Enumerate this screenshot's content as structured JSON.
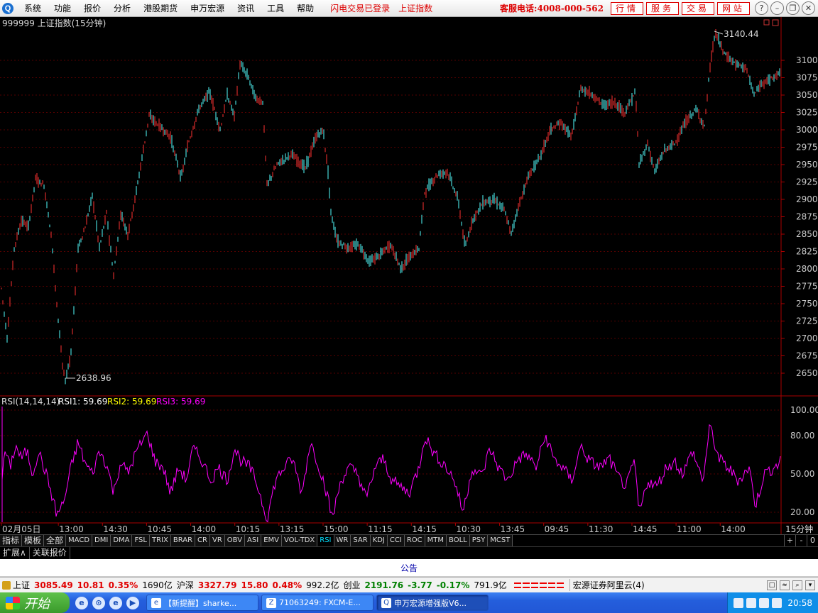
{
  "menubar": {
    "logo": "Q",
    "items": [
      "系统",
      "功能",
      "报价",
      "分析",
      "港股期货",
      "申万宏源",
      "资讯",
      "工具",
      "帮助"
    ],
    "notice_login": "闪电交易已登录",
    "notice_index": "上证指数",
    "hotline": "客服电话:4008-000-562",
    "buttons": [
      "行情",
      "服务",
      "交易",
      "网站"
    ]
  },
  "chart": {
    "title": "999999 上证指数(15分钟)",
    "y_ticks": [
      "3100",
      "3075",
      "3050",
      "3025",
      "3000",
      "2975",
      "2950",
      "2925",
      "2900",
      "2875",
      "2850",
      "2825",
      "2800",
      "2775",
      "2750",
      "2725",
      "2700",
      "2675",
      "2650"
    ],
    "high_label": "3140.44",
    "low_label": "2638.96",
    "rsi_legend": {
      "name": "RSI(14,14,14)",
      "rsi1": "RSI1: 59.69",
      "rsi2": "RSI2: 59.69",
      "rsi3": "RSI3: 59.69"
    },
    "rsi_ticks": [
      "100.00",
      "80.00",
      "50.00",
      "20.00"
    ],
    "x_labels": [
      "02月05日",
      "13:00",
      "14:30",
      "10:45",
      "14:00",
      "10:15",
      "13:15",
      "15:00",
      "11:15",
      "14:15",
      "10:30",
      "13:45",
      "09:45",
      "11:30",
      "14:45",
      "11:00",
      "14:00"
    ],
    "period": "15分钟"
  },
  "chart_data": {
    "type": "candlestick",
    "title": "999999 上证指数(15分钟)",
    "ylim": [
      2620,
      3150
    ],
    "high": 3140.44,
    "low": 2638.96,
    "last_close": 3085.49,
    "price_path": [
      {
        "x": 0,
        "y": 2790
      },
      {
        "x": 10,
        "y": 2700
      },
      {
        "x": 20,
        "y": 2830
      },
      {
        "x": 30,
        "y": 2870
      },
      {
        "x": 40,
        "y": 2860
      },
      {
        "x": 50,
        "y": 2930
      },
      {
        "x": 62,
        "y": 2920
      },
      {
        "x": 72,
        "y": 2850
      },
      {
        "x": 80,
        "y": 2750
      },
      {
        "x": 88,
        "y": 2660
      },
      {
        "x": 92,
        "y": 2639
      },
      {
        "x": 100,
        "y": 2680
      },
      {
        "x": 110,
        "y": 2830
      },
      {
        "x": 120,
        "y": 2860
      },
      {
        "x": 130,
        "y": 2905
      },
      {
        "x": 140,
        "y": 2830
      },
      {
        "x": 150,
        "y": 2880
      },
      {
        "x": 160,
        "y": 2790
      },
      {
        "x": 170,
        "y": 2880
      },
      {
        "x": 180,
        "y": 2850
      },
      {
        "x": 190,
        "y": 2900
      },
      {
        "x": 200,
        "y": 2960
      },
      {
        "x": 210,
        "y": 3020
      },
      {
        "x": 225,
        "y": 3005
      },
      {
        "x": 240,
        "y": 2990
      },
      {
        "x": 255,
        "y": 2930
      },
      {
        "x": 265,
        "y": 2980
      },
      {
        "x": 280,
        "y": 3030
      },
      {
        "x": 295,
        "y": 3055
      },
      {
        "x": 310,
        "y": 3000
      },
      {
        "x": 320,
        "y": 3050
      },
      {
        "x": 330,
        "y": 3020
      },
      {
        "x": 338,
        "y": 3095
      },
      {
        "x": 350,
        "y": 3075
      },
      {
        "x": 360,
        "y": 3045
      },
      {
        "x": 370,
        "y": 3040
      },
      {
        "x": 376,
        "y": 2920
      },
      {
        "x": 390,
        "y": 2950
      },
      {
        "x": 410,
        "y": 2965
      },
      {
        "x": 430,
        "y": 2945
      },
      {
        "x": 445,
        "y": 2990
      },
      {
        "x": 455,
        "y": 3000
      },
      {
        "x": 462,
        "y": 2940
      },
      {
        "x": 466,
        "y": 2880
      },
      {
        "x": 475,
        "y": 2840
      },
      {
        "x": 490,
        "y": 2830
      },
      {
        "x": 505,
        "y": 2835
      },
      {
        "x": 520,
        "y": 2810
      },
      {
        "x": 535,
        "y": 2820
      },
      {
        "x": 550,
        "y": 2835
      },
      {
        "x": 565,
        "y": 2800
      },
      {
        "x": 575,
        "y": 2815
      },
      {
        "x": 590,
        "y": 2830
      },
      {
        "x": 598,
        "y": 2910
      },
      {
        "x": 615,
        "y": 2935
      },
      {
        "x": 630,
        "y": 2940
      },
      {
        "x": 645,
        "y": 2900
      },
      {
        "x": 655,
        "y": 2830
      },
      {
        "x": 665,
        "y": 2870
      },
      {
        "x": 680,
        "y": 2895
      },
      {
        "x": 695,
        "y": 2900
      },
      {
        "x": 710,
        "y": 2885
      },
      {
        "x": 720,
        "y": 2850
      },
      {
        "x": 730,
        "y": 2890
      },
      {
        "x": 745,
        "y": 2935
      },
      {
        "x": 760,
        "y": 2960
      },
      {
        "x": 775,
        "y": 3000
      },
      {
        "x": 790,
        "y": 3010
      },
      {
        "x": 805,
        "y": 2990
      },
      {
        "x": 818,
        "y": 3060
      },
      {
        "x": 835,
        "y": 3050
      },
      {
        "x": 850,
        "y": 3035
      },
      {
        "x": 865,
        "y": 3040
      },
      {
        "x": 880,
        "y": 3025
      },
      {
        "x": 895,
        "y": 3055
      },
      {
        "x": 900,
        "y": 2950
      },
      {
        "x": 912,
        "y": 2980
      },
      {
        "x": 922,
        "y": 2940
      },
      {
        "x": 935,
        "y": 2970
      },
      {
        "x": 950,
        "y": 2980
      },
      {
        "x": 965,
        "y": 3010
      },
      {
        "x": 980,
        "y": 3030
      },
      {
        "x": 992,
        "y": 3005
      },
      {
        "x": 1000,
        "y": 3090
      },
      {
        "x": 1007,
        "y": 3140
      },
      {
        "x": 1020,
        "y": 3110
      },
      {
        "x": 1035,
        "y": 3095
      },
      {
        "x": 1050,
        "y": 3090
      },
      {
        "x": 1062,
        "y": 3050
      },
      {
        "x": 1075,
        "y": 3070
      },
      {
        "x": 1090,
        "y": 3075
      },
      {
        "x": 1100,
        "y": 3085
      }
    ],
    "rsi_path": [
      {
        "x": 0,
        "y": 12
      },
      {
        "x": 6,
        "y": 70
      },
      {
        "x": 14,
        "y": 55
      },
      {
        "x": 22,
        "y": 72
      },
      {
        "x": 30,
        "y": 62
      },
      {
        "x": 38,
        "y": 68
      },
      {
        "x": 46,
        "y": 50
      },
      {
        "x": 54,
        "y": 68
      },
      {
        "x": 62,
        "y": 55
      },
      {
        "x": 70,
        "y": 40
      },
      {
        "x": 80,
        "y": 18
      },
      {
        "x": 90,
        "y": 28
      },
      {
        "x": 100,
        "y": 55
      },
      {
        "x": 110,
        "y": 75
      },
      {
        "x": 120,
        "y": 58
      },
      {
        "x": 130,
        "y": 50
      },
      {
        "x": 140,
        "y": 68
      },
      {
        "x": 150,
        "y": 58
      },
      {
        "x": 160,
        "y": 35
      },
      {
        "x": 170,
        "y": 60
      },
      {
        "x": 180,
        "y": 50
      },
      {
        "x": 190,
        "y": 65
      },
      {
        "x": 200,
        "y": 75
      },
      {
        "x": 208,
        "y": 82
      },
      {
        "x": 218,
        "y": 60
      },
      {
        "x": 230,
        "y": 55
      },
      {
        "x": 240,
        "y": 35
      },
      {
        "x": 252,
        "y": 55
      },
      {
        "x": 262,
        "y": 45
      },
      {
        "x": 272,
        "y": 70
      },
      {
        "x": 285,
        "y": 60
      },
      {
        "x": 297,
        "y": 45
      },
      {
        "x": 308,
        "y": 55
      },
      {
        "x": 320,
        "y": 45
      },
      {
        "x": 330,
        "y": 70
      },
      {
        "x": 340,
        "y": 60
      },
      {
        "x": 352,
        "y": 55
      },
      {
        "x": 362,
        "y": 42
      },
      {
        "x": 376,
        "y": 15
      },
      {
        "x": 388,
        "y": 45
      },
      {
        "x": 400,
        "y": 55
      },
      {
        "x": 412,
        "y": 62
      },
      {
        "x": 425,
        "y": 35
      },
      {
        "x": 437,
        "y": 75
      },
      {
        "x": 447,
        "y": 60
      },
      {
        "x": 458,
        "y": 40
      },
      {
        "x": 468,
        "y": 15
      },
      {
        "x": 480,
        "y": 45
      },
      {
        "x": 492,
        "y": 55
      },
      {
        "x": 504,
        "y": 50
      },
      {
        "x": 516,
        "y": 30
      },
      {
        "x": 528,
        "y": 55
      },
      {
        "x": 540,
        "y": 62
      },
      {
        "x": 552,
        "y": 45
      },
      {
        "x": 564,
        "y": 40
      },
      {
        "x": 576,
        "y": 35
      },
      {
        "x": 590,
        "y": 55
      },
      {
        "x": 598,
        "y": 80
      },
      {
        "x": 612,
        "y": 65
      },
      {
        "x": 625,
        "y": 58
      },
      {
        "x": 640,
        "y": 45
      },
      {
        "x": 652,
        "y": 20
      },
      {
        "x": 665,
        "y": 55
      },
      {
        "x": 678,
        "y": 48
      },
      {
        "x": 690,
        "y": 70
      },
      {
        "x": 702,
        "y": 55
      },
      {
        "x": 715,
        "y": 45
      },
      {
        "x": 730,
        "y": 62
      },
      {
        "x": 742,
        "y": 65
      },
      {
        "x": 755,
        "y": 55
      },
      {
        "x": 768,
        "y": 80
      },
      {
        "x": 780,
        "y": 62
      },
      {
        "x": 792,
        "y": 55
      },
      {
        "x": 805,
        "y": 45
      },
      {
        "x": 818,
        "y": 72
      },
      {
        "x": 830,
        "y": 60
      },
      {
        "x": 845,
        "y": 55
      },
      {
        "x": 858,
        "y": 62
      },
      {
        "x": 870,
        "y": 48
      },
      {
        "x": 882,
        "y": 40
      },
      {
        "x": 894,
        "y": 60
      },
      {
        "x": 900,
        "y": 18
      },
      {
        "x": 912,
        "y": 45
      },
      {
        "x": 925,
        "y": 40
      },
      {
        "x": 938,
        "y": 55
      },
      {
        "x": 950,
        "y": 60
      },
      {
        "x": 962,
        "y": 50
      },
      {
        "x": 975,
        "y": 68
      },
      {
        "x": 990,
        "y": 45
      },
      {
        "x": 1000,
        "y": 88
      },
      {
        "x": 1012,
        "y": 62
      },
      {
        "x": 1025,
        "y": 55
      },
      {
        "x": 1040,
        "y": 45
      },
      {
        "x": 1055,
        "y": 55
      },
      {
        "x": 1064,
        "y": 25
      },
      {
        "x": 1076,
        "y": 50
      },
      {
        "x": 1090,
        "y": 55
      },
      {
        "x": 1100,
        "y": 60
      }
    ]
  },
  "indicator_tabs": {
    "items": [
      "指标",
      "模板",
      "全部",
      "MACD",
      "DMI",
      "DMA",
      "FSL",
      "TRIX",
      "BRAR",
      "CR",
      "VR",
      "OBV",
      "ASI",
      "EMV",
      "VOL-TDX",
      "RSI",
      "WR",
      "SAR",
      "KDJ",
      "CCI",
      "ROC",
      "MTM",
      "BOLL",
      "PSY",
      "MCST"
    ],
    "active": "RSI",
    "right_buttons": [
      "+",
      "-",
      "0"
    ]
  },
  "ext_bar": {
    "expand": "扩展∧",
    "related": "关联报价"
  },
  "announcement": "公告",
  "status_bar": {
    "sh_label": "上证",
    "sh_value": "3085.49",
    "sh_change": "10.81",
    "sh_pct": "0.35%",
    "sh_amount": "1690亿",
    "hs_label": "沪深",
    "hs_value": "3327.79",
    "hs_change": "15.80",
    "hs_pct": "0.48%",
    "hs_amount": "992.2亿",
    "cy_label": "创业",
    "cy_value": "2191.76",
    "cy_change": "-3.77",
    "cy_pct": "-0.17%",
    "cy_amount": "791.9亿",
    "provider": "宏源证券阿里云(4)"
  },
  "taskbar": {
    "start": "开始",
    "tasks": [
      "【新提醒】sharke...",
      "71063249: FXCM-E...",
      "申万宏源增强版V6..."
    ],
    "clock": "20:58"
  },
  "colors": {
    "up": "#ff3232",
    "down": "#54ffff",
    "rsi": "#ff00ff",
    "axis": "#aa0000",
    "grid": "#550000"
  }
}
